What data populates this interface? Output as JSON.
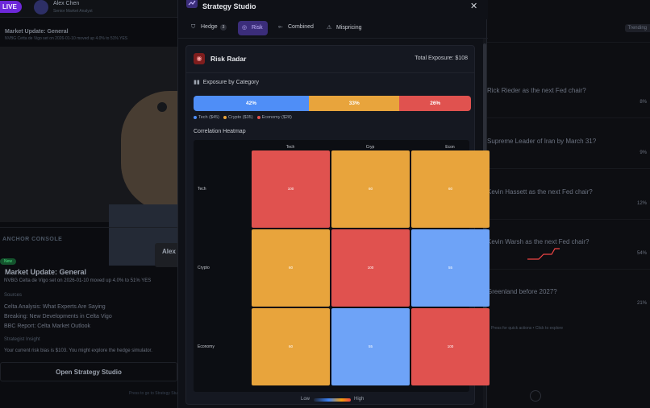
{
  "background": {
    "live_badge": "LIVE",
    "user": {
      "name": "Alex Chen",
      "subtitle": "Senior Market Analyst"
    },
    "market_update_banner": "Market Update: General",
    "market_update_text": "NVBG Cetta de Vigo set on 2026-01-10 moved up 4.0% to 51% YES",
    "video_label": "Alex",
    "video_sublabel": "Senior",
    "anchor_console": "ANCHOR CONSOLE",
    "new_pill": "New",
    "market_update_title": "Market Update: General",
    "market_update_body": "NVBG Celta de Vigo set on 2026-01-10 moved up 4.0% to 51% YES",
    "sources_label": "Sources",
    "sources": [
      "Celta Analysis: What Experts Are Saying",
      "Breaking: New Developments in Celta Vigo",
      "BBC Report: Celta Market Outlook"
    ],
    "strategist_label": "Strategist Insight",
    "strategist_text": "Your current risk bias is $103. You might explore the hedge simulator.",
    "open_button": "Open Strategy Studio",
    "footer_hint": "Press to go to Strategy Studio",
    "right_items": [
      {
        "text": "Rick Rieder as the next Fed chair?",
        "value": "8%"
      },
      {
        "text": "Supreme Leader of Iran by March 31?",
        "value": "9%"
      },
      {
        "text": "Kevin Hassett as the next Fed chair?",
        "value": "12%"
      },
      {
        "text": "Kevin Warsh as the next Fed chair?",
        "value": "54%"
      },
      {
        "text": "Greenland before 2027?",
        "value": "21%"
      }
    ],
    "right_tag": "Trending",
    "right_footer": "Press for quick actions • Click to explore"
  },
  "modal": {
    "title": "Strategy Studio",
    "close_icon": "close-icon",
    "tabs": [
      {
        "label": "Hedge",
        "badge": "3",
        "icon": "shield-icon"
      },
      {
        "label": "Risk",
        "icon": "radar-icon",
        "active": true
      },
      {
        "label": "Combined",
        "icon": "merge-icon"
      },
      {
        "label": "Mispricing",
        "icon": "warning-icon"
      }
    ],
    "risk_radar": {
      "title": "Risk Radar",
      "total_exposure": "Total Exposure: $108",
      "exposure_title": "Exposure by Category",
      "segments": [
        {
          "label": "42%",
          "value": 42,
          "color": "#4f8ef7"
        },
        {
          "label": "33%",
          "value": 33,
          "color": "#e8a43c"
        },
        {
          "label": "26%",
          "value": 26,
          "color": "#e0524f"
        }
      ],
      "legend": [
        {
          "label": "Tech ($45)",
          "color": "#4f8ef7"
        },
        {
          "label": "Crypto ($35)",
          "color": "#e8a43c"
        },
        {
          "label": "Economy ($28)",
          "color": "#e0524f"
        }
      ],
      "heatmap_title": "Correlation Heatmap",
      "heatmap": {
        "columns": [
          "Tech",
          "Cryp",
          "Econ"
        ],
        "rows": [
          "Tech",
          "Crypto",
          "Economy"
        ],
        "values": [
          [
            "100",
            "60",
            "60"
          ],
          [
            "60",
            "100",
            "55"
          ],
          [
            "60",
            "55",
            "100"
          ]
        ],
        "colors": [
          [
            "#e0524f",
            "#e8a43c",
            "#e8a43c"
          ],
          [
            "#e8a43c",
            "#e0524f",
            "#6ea3f7"
          ],
          [
            "#e8a43c",
            "#6ea3f7",
            "#e0524f"
          ]
        ]
      },
      "scale": {
        "low": "Low",
        "high": "High"
      }
    }
  }
}
